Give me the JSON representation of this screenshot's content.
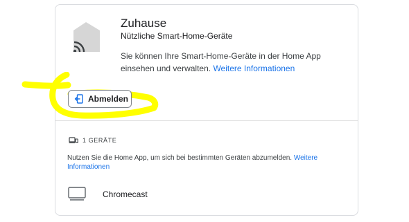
{
  "home": {
    "title": "Zuhause",
    "subtitle": "Nützliche Smart-Home-Geräte",
    "description": "Sie können Ihre Smart-Home-Geräte in der Home App einsehen und verwalten.",
    "learn_more": "Weitere Informationen",
    "icon": "home-wifi-icon"
  },
  "logout": {
    "label": "Abmelden",
    "icon": "logout-icon"
  },
  "devices": {
    "count_label": "1 GERÄTE",
    "icon": "devices-icon",
    "hint": "Nutzen Sie die Home App, um sich bei bestimmten Geräten abzumelden.",
    "hint_link": "Weitere Informationen",
    "items": [
      {
        "name": "Chromecast",
        "icon": "tv-icon"
      }
    ]
  },
  "colors": {
    "link": "#1a73e8",
    "highlight": "#ffff00",
    "border": "#dadce0"
  }
}
